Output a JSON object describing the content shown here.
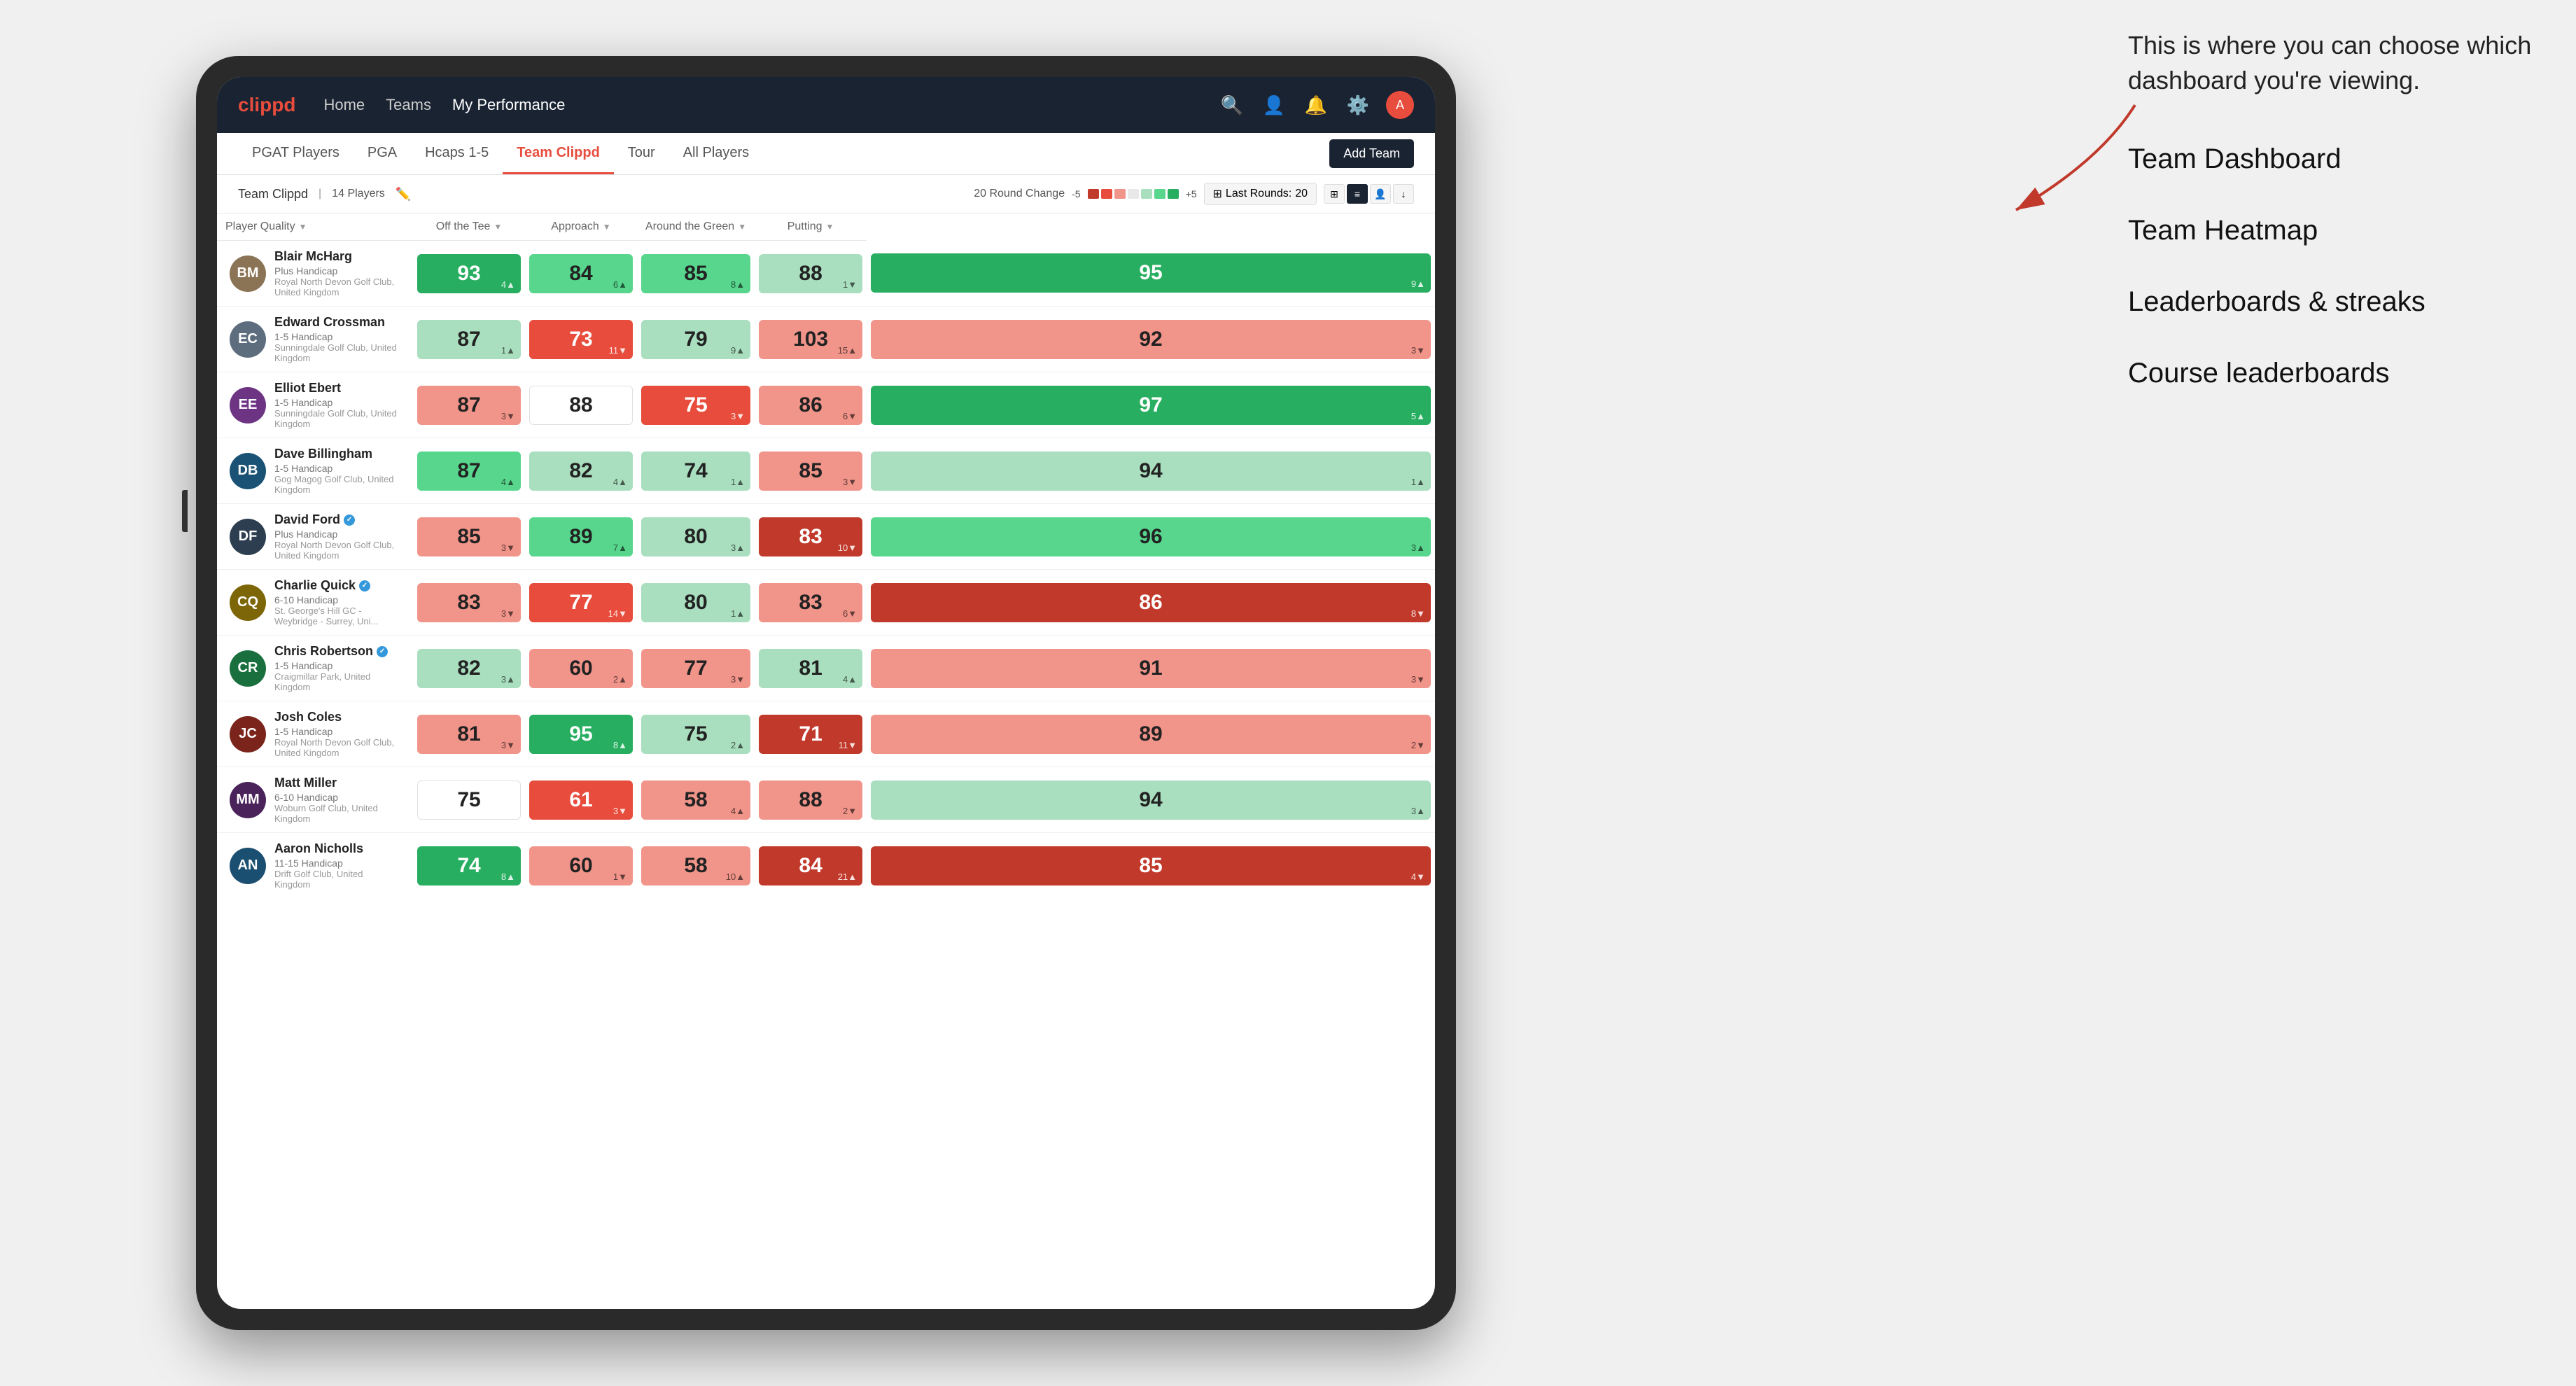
{
  "annotation": {
    "intro_text": "This is where you can choose which dashboard you're viewing.",
    "menu_items": [
      "Team Dashboard",
      "Team Heatmap",
      "Leaderboards & streaks",
      "Course leaderboards"
    ]
  },
  "nav": {
    "logo": "clippd",
    "links": [
      "Home",
      "Teams",
      "My Performance"
    ],
    "active_link": "My Performance",
    "icons": [
      "search",
      "person",
      "bell",
      "settings",
      "avatar"
    ]
  },
  "tabs": {
    "items": [
      "PGAT Players",
      "PGA",
      "Hcaps 1-5",
      "Team Clippd",
      "Tour",
      "All Players"
    ],
    "active": "Team Clippd",
    "add_button": "Add Team"
  },
  "sub_header": {
    "team_label": "Team Clippd",
    "player_count": "14 Players",
    "round_change_label": "20 Round Change",
    "scale_minus": "-5",
    "scale_plus": "+5",
    "last_rounds_label": "Last Rounds:",
    "last_rounds_value": "20"
  },
  "table": {
    "columns": {
      "player": "Player Quality",
      "off_tee": "Off the Tee",
      "approach": "Approach",
      "around_green": "Around the Green",
      "putting": "Putting"
    },
    "rows": [
      {
        "name": "Blair McHarg",
        "handicap": "Plus Handicap",
        "club": "Royal North Devon Golf Club, United Kingdom",
        "avatar_color": "#8B7355",
        "initials": "BM",
        "scores": {
          "player_quality": {
            "value": "93",
            "change": "4",
            "dir": "up",
            "bg": "bg-green-dark",
            "white": true
          },
          "off_tee": {
            "value": "84",
            "change": "6",
            "dir": "up",
            "bg": "bg-green-med",
            "white": false
          },
          "approach": {
            "value": "85",
            "change": "8",
            "dir": "up",
            "bg": "bg-green-med",
            "white": false
          },
          "around_green": {
            "value": "88",
            "change": "1",
            "dir": "down",
            "bg": "bg-green-light",
            "white": false
          },
          "putting": {
            "value": "95",
            "change": "9",
            "dir": "up",
            "bg": "bg-green-dark",
            "white": true
          }
        }
      },
      {
        "name": "Edward Crossman",
        "handicap": "1-5 Handicap",
        "club": "Sunningdale Golf Club, United Kingdom",
        "avatar_color": "#5D6D7E",
        "initials": "EC",
        "scores": {
          "player_quality": {
            "value": "87",
            "change": "1",
            "dir": "up",
            "bg": "bg-green-light",
            "white": false
          },
          "off_tee": {
            "value": "73",
            "change": "11",
            "dir": "down",
            "bg": "bg-red-med",
            "white": true
          },
          "approach": {
            "value": "79",
            "change": "9",
            "dir": "up",
            "bg": "bg-green-light",
            "white": false
          },
          "around_green": {
            "value": "103",
            "change": "15",
            "dir": "up",
            "bg": "bg-red-light",
            "white": false
          },
          "putting": {
            "value": "92",
            "change": "3",
            "dir": "down",
            "bg": "bg-red-light",
            "white": false
          }
        }
      },
      {
        "name": "Elliot Ebert",
        "handicap": "1-5 Handicap",
        "club": "Sunningdale Golf Club, United Kingdom",
        "avatar_color": "#6C3483",
        "initials": "EE",
        "scores": {
          "player_quality": {
            "value": "87",
            "change": "3",
            "dir": "down",
            "bg": "bg-red-light",
            "white": false
          },
          "off_tee": {
            "value": "88",
            "change": "",
            "dir": "",
            "bg": "bg-white",
            "white": false
          },
          "approach": {
            "value": "75",
            "change": "3",
            "dir": "down",
            "bg": "bg-red-med",
            "white": true
          },
          "around_green": {
            "value": "86",
            "change": "6",
            "dir": "down",
            "bg": "bg-red-light",
            "white": false
          },
          "putting": {
            "value": "97",
            "change": "5",
            "dir": "up",
            "bg": "bg-green-dark",
            "white": true
          }
        }
      },
      {
        "name": "Dave Billingham",
        "handicap": "1-5 Handicap",
        "club": "Gog Magog Golf Club, United Kingdom",
        "avatar_color": "#1A5276",
        "initials": "DB",
        "scores": {
          "player_quality": {
            "value": "87",
            "change": "4",
            "dir": "up",
            "bg": "bg-green-med",
            "white": false
          },
          "off_tee": {
            "value": "82",
            "change": "4",
            "dir": "up",
            "bg": "bg-green-light",
            "white": false
          },
          "approach": {
            "value": "74",
            "change": "1",
            "dir": "up",
            "bg": "bg-green-light",
            "white": false
          },
          "around_green": {
            "value": "85",
            "change": "3",
            "dir": "down",
            "bg": "bg-red-light",
            "white": false
          },
          "putting": {
            "value": "94",
            "change": "1",
            "dir": "up",
            "bg": "bg-green-light",
            "white": false
          }
        }
      },
      {
        "name": "David Ford",
        "handicap": "Plus Handicap",
        "club": "Royal North Devon Golf Club, United Kingdom",
        "avatar_color": "#2C3E50",
        "initials": "DF",
        "verified": true,
        "scores": {
          "player_quality": {
            "value": "85",
            "change": "3",
            "dir": "down",
            "bg": "bg-red-light",
            "white": false
          },
          "off_tee": {
            "value": "89",
            "change": "7",
            "dir": "up",
            "bg": "bg-green-med",
            "white": false
          },
          "approach": {
            "value": "80",
            "change": "3",
            "dir": "up",
            "bg": "bg-green-light",
            "white": false
          },
          "around_green": {
            "value": "83",
            "change": "10",
            "dir": "down",
            "bg": "bg-red-dark",
            "white": true
          },
          "putting": {
            "value": "96",
            "change": "3",
            "dir": "up",
            "bg": "bg-green-med",
            "white": false
          }
        }
      },
      {
        "name": "Charlie Quick",
        "handicap": "6-10 Handicap",
        "club": "St. George's Hill GC - Weybridge - Surrey, Uni...",
        "avatar_color": "#7D6608",
        "initials": "CQ",
        "verified": true,
        "scores": {
          "player_quality": {
            "value": "83",
            "change": "3",
            "dir": "down",
            "bg": "bg-red-light",
            "white": false
          },
          "off_tee": {
            "value": "77",
            "change": "14",
            "dir": "down",
            "bg": "bg-red-med",
            "white": true
          },
          "approach": {
            "value": "80",
            "change": "1",
            "dir": "up",
            "bg": "bg-green-light",
            "white": false
          },
          "around_green": {
            "value": "83",
            "change": "6",
            "dir": "down",
            "bg": "bg-red-light",
            "white": false
          },
          "putting": {
            "value": "86",
            "change": "8",
            "dir": "down",
            "bg": "bg-red-dark",
            "white": true
          }
        }
      },
      {
        "name": "Chris Robertson",
        "handicap": "1-5 Handicap",
        "club": "Craigmillar Park, United Kingdom",
        "avatar_color": "#196F3D",
        "initials": "CR",
        "verified": true,
        "scores": {
          "player_quality": {
            "value": "82",
            "change": "3",
            "dir": "up",
            "bg": "bg-green-light",
            "white": false
          },
          "off_tee": {
            "value": "60",
            "change": "2",
            "dir": "up",
            "bg": "bg-red-light",
            "white": false
          },
          "approach": {
            "value": "77",
            "change": "3",
            "dir": "down",
            "bg": "bg-red-light",
            "white": false
          },
          "around_green": {
            "value": "81",
            "change": "4",
            "dir": "up",
            "bg": "bg-green-light",
            "white": false
          },
          "putting": {
            "value": "91",
            "change": "3",
            "dir": "down",
            "bg": "bg-red-light",
            "white": false
          }
        }
      },
      {
        "name": "Josh Coles",
        "handicap": "1-5 Handicap",
        "club": "Royal North Devon Golf Club, United Kingdom",
        "avatar_color": "#7B241C",
        "initials": "JC",
        "scores": {
          "player_quality": {
            "value": "81",
            "change": "3",
            "dir": "down",
            "bg": "bg-red-light",
            "white": false
          },
          "off_tee": {
            "value": "95",
            "change": "8",
            "dir": "up",
            "bg": "bg-green-dark",
            "white": true
          },
          "approach": {
            "value": "75",
            "change": "2",
            "dir": "up",
            "bg": "bg-green-light",
            "white": false
          },
          "around_green": {
            "value": "71",
            "change": "11",
            "dir": "down",
            "bg": "bg-red-dark",
            "white": true
          },
          "putting": {
            "value": "89",
            "change": "2",
            "dir": "down",
            "bg": "bg-red-light",
            "white": false
          }
        }
      },
      {
        "name": "Matt Miller",
        "handicap": "6-10 Handicap",
        "club": "Woburn Golf Club, United Kingdom",
        "avatar_color": "#4A235A",
        "initials": "MM",
        "scores": {
          "player_quality": {
            "value": "75",
            "change": "",
            "dir": "",
            "bg": "bg-white",
            "white": false
          },
          "off_tee": {
            "value": "61",
            "change": "3",
            "dir": "down",
            "bg": "bg-red-med",
            "white": true
          },
          "approach": {
            "value": "58",
            "change": "4",
            "dir": "up",
            "bg": "bg-red-light",
            "white": false
          },
          "around_green": {
            "value": "88",
            "change": "2",
            "dir": "down",
            "bg": "bg-red-light",
            "white": false
          },
          "putting": {
            "value": "94",
            "change": "3",
            "dir": "up",
            "bg": "bg-green-light",
            "white": false
          }
        }
      },
      {
        "name": "Aaron Nicholls",
        "handicap": "11-15 Handicap",
        "club": "Drift Golf Club, United Kingdom",
        "avatar_color": "#1B4F72",
        "initials": "AN",
        "scores": {
          "player_quality": {
            "value": "74",
            "change": "8",
            "dir": "up",
            "bg": "bg-green-dark",
            "white": true
          },
          "off_tee": {
            "value": "60",
            "change": "1",
            "dir": "down",
            "bg": "bg-red-light",
            "white": false
          },
          "approach": {
            "value": "58",
            "change": "10",
            "dir": "up",
            "bg": "bg-red-light",
            "white": false
          },
          "around_green": {
            "value": "84",
            "change": "21",
            "dir": "up",
            "bg": "bg-red-dark",
            "white": true
          },
          "putting": {
            "value": "85",
            "change": "4",
            "dir": "down",
            "bg": "bg-red-dark",
            "white": true
          }
        }
      }
    ]
  },
  "colors": {
    "green_dark": "#27ae60",
    "green_med": "#58d68d",
    "green_light": "#a9dfbf",
    "red_light": "#f1948a",
    "red_med": "#e74c3c",
    "red_dark": "#c0392b",
    "nav_bg": "#1a2332",
    "brand_red": "#e74c3c"
  }
}
